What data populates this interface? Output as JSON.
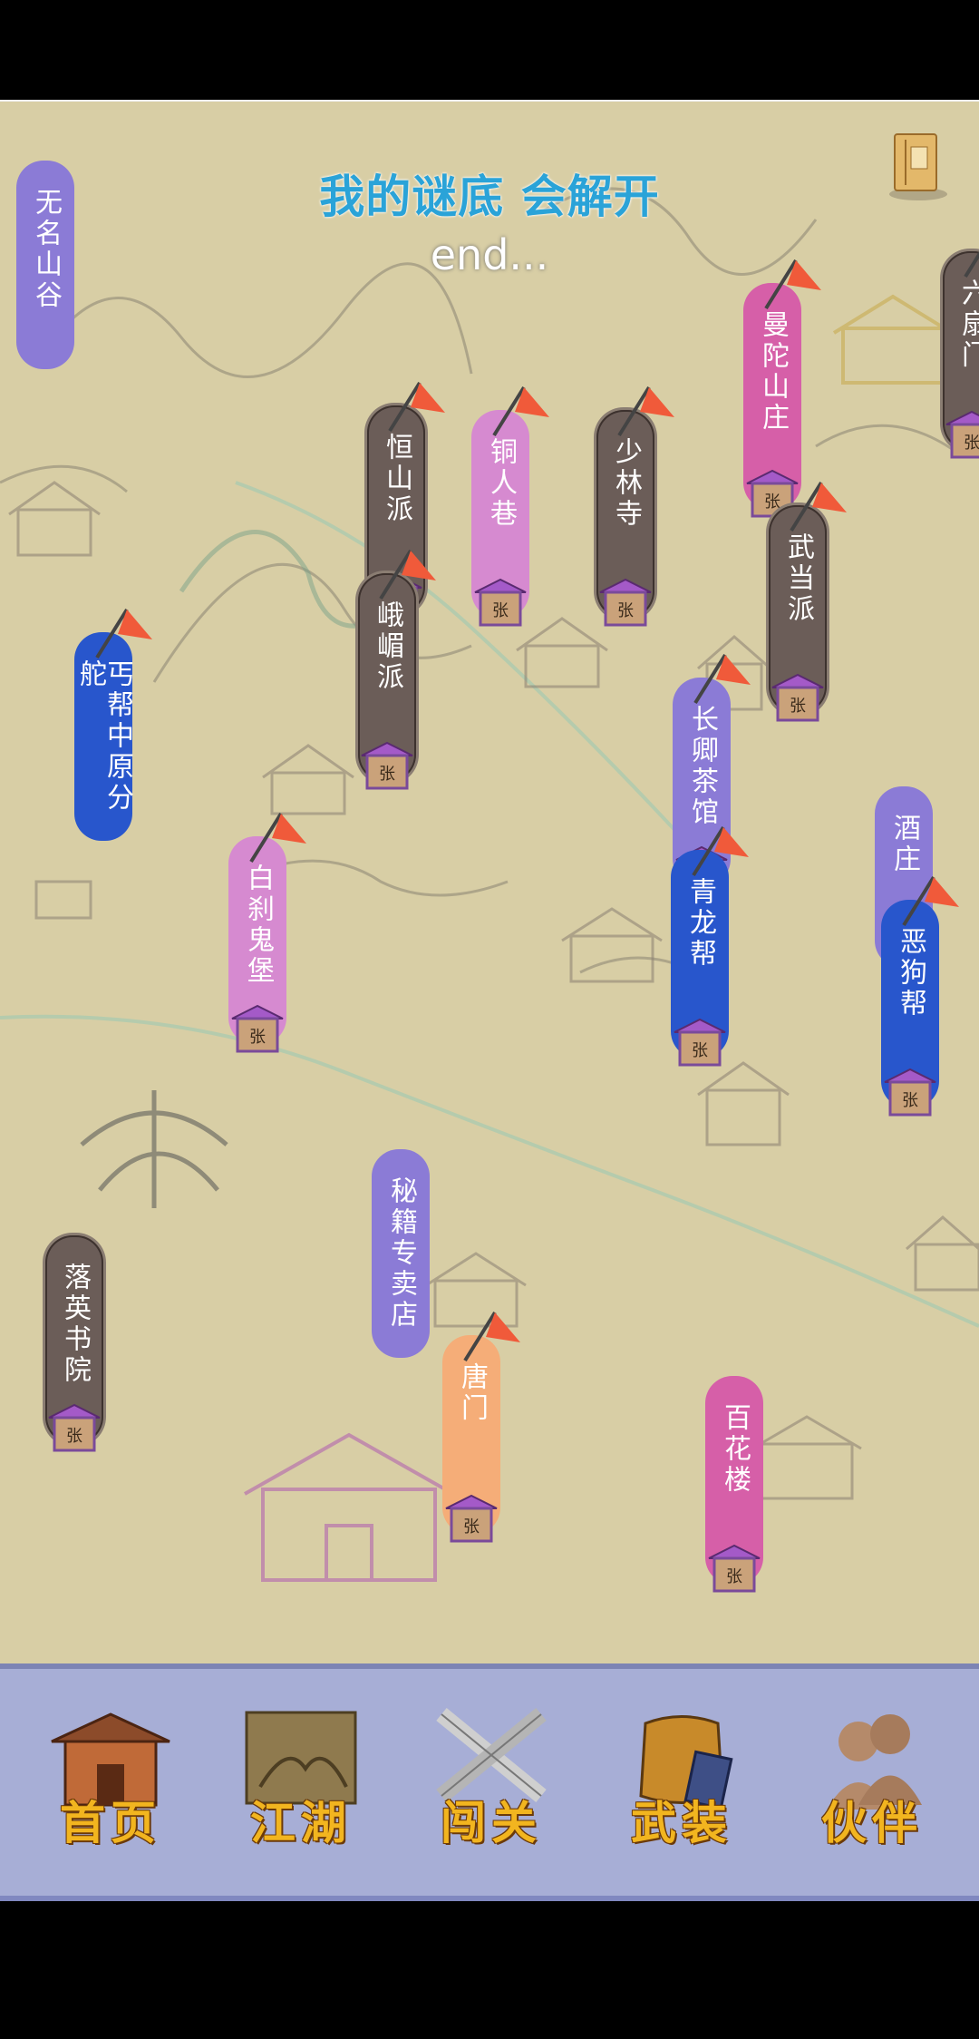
{
  "header": {
    "title": "我的谜底 会解开",
    "subtitle": "end..."
  },
  "locations": [
    {
      "id": "wuming",
      "name": "无名山谷",
      "color": "#8b7bd6",
      "plaque": false,
      "flag": false
    },
    {
      "id": "liushan",
      "name": "六扇门",
      "color": "#6b5d58",
      "plaque": true,
      "plaque_text": "张",
      "flag": true
    },
    {
      "id": "mantuo",
      "name": "曼陀山庄",
      "color": "#d65fa8",
      "plaque": true,
      "plaque_text": "张",
      "flag": true
    },
    {
      "id": "hengshan",
      "name": "恒山派",
      "color": "#6b5d58",
      "plaque": true,
      "plaque_text": "张",
      "flag": true
    },
    {
      "id": "tongren",
      "name": "铜人巷",
      "color": "#d68ad0",
      "plaque": true,
      "plaque_text": "张",
      "flag": true
    },
    {
      "id": "shaolin",
      "name": "少林寺",
      "color": "#6b5d58",
      "plaque": true,
      "plaque_text": "张",
      "flag": true
    },
    {
      "id": "wudang",
      "name": "武当派",
      "color": "#6b5d58",
      "plaque": true,
      "plaque_text": "张",
      "flag": true
    },
    {
      "id": "emei",
      "name": "峨嵋派",
      "color": "#6b5d58",
      "plaque": true,
      "plaque_text": "张",
      "flag": true
    },
    {
      "id": "gaibang",
      "name": "丐帮中原分舵",
      "color": "#2856cc",
      "plaque": false,
      "flag": true
    },
    {
      "id": "changqing",
      "name": "长卿茶馆",
      "color": "#8b7bd6",
      "plaque": true,
      "plaque_text": "张",
      "flag": true
    },
    {
      "id": "jiuzhuang",
      "name": "酒庄",
      "color": "#8b7bd6",
      "plaque": false,
      "flag": false
    },
    {
      "id": "baisha",
      "name": "白刹鬼堡",
      "color": "#d68ad0",
      "plaque": true,
      "plaque_text": "张",
      "flag": true
    },
    {
      "id": "qinglong",
      "name": "青龙帮",
      "color": "#2856cc",
      "plaque": true,
      "plaque_text": "张",
      "flag": true
    },
    {
      "id": "egou",
      "name": "恶狗帮",
      "color": "#2856cc",
      "plaque": true,
      "plaque_text": "张",
      "flag": true
    },
    {
      "id": "miji",
      "name": "秘籍专卖店",
      "color": "#8b7bd6",
      "plaque": false,
      "flag": false
    },
    {
      "id": "luoying",
      "name": "落英书院",
      "color": "#6b5d58",
      "plaque": true,
      "plaque_text": "张",
      "flag": false
    },
    {
      "id": "tangmen",
      "name": "唐门",
      "color": "#f5ad78",
      "plaque": true,
      "plaque_text": "张",
      "flag": true
    },
    {
      "id": "baihua",
      "name": "百花楼",
      "color": "#d65fa8",
      "plaque": true,
      "plaque_text": "张",
      "flag": false
    }
  ],
  "nav": {
    "items": [
      {
        "id": "home",
        "label": "首页",
        "icon": "house-icon"
      },
      {
        "id": "jianghu",
        "label": "江湖",
        "icon": "scroll-map-icon"
      },
      {
        "id": "chuangguan",
        "label": "闯关",
        "icon": "crossed-swords-icon"
      },
      {
        "id": "wuzhuang",
        "label": "武装",
        "icon": "armor-icon"
      },
      {
        "id": "huoban",
        "label": "伙伴",
        "icon": "partners-icon"
      }
    ]
  }
}
